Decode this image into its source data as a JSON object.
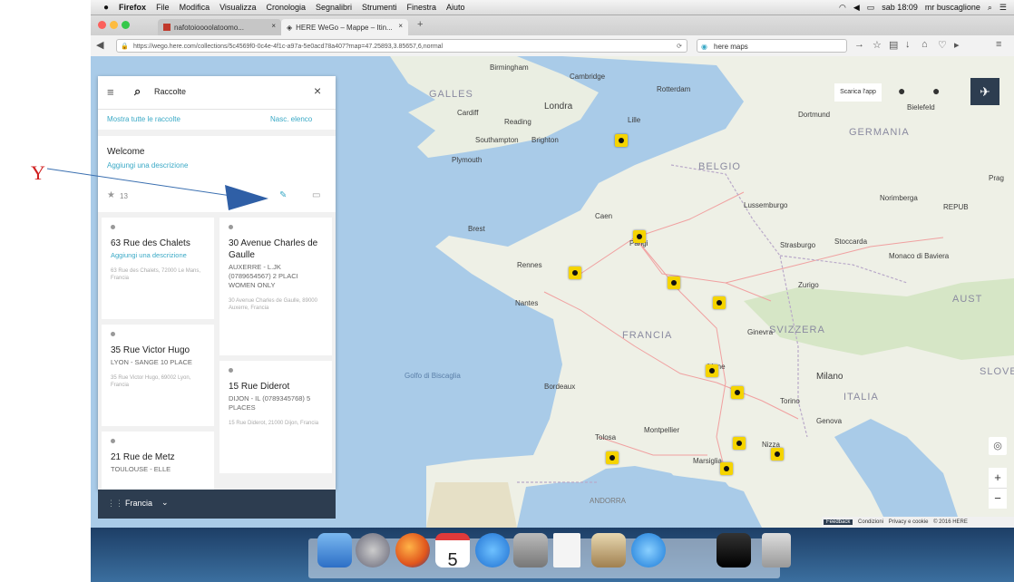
{
  "annotation": {
    "letter": "Y",
    "color": "#d02020"
  },
  "menubar": {
    "apple": "",
    "items": [
      "Firefox",
      "File",
      "Modifica",
      "Visualizza",
      "Cronologia",
      "Segnalibri",
      "Strumenti",
      "Finestra",
      "Aiuto"
    ],
    "clock": "sab 18:09",
    "user": "mr buscaglione"
  },
  "tabs": [
    {
      "label": "nafotoioooolatoomo..."
    },
    {
      "label": "HERE WeGo – Mappe – Itin..."
    }
  ],
  "navbar": {
    "url": "https://wego.here.com/collections/5c4569f0-0c4e-4f1c-a97a-5e0acd78a407?map=47.25893,3.85657,6,normal",
    "search_value": "here maps"
  },
  "panel": {
    "search_label": "Raccolte",
    "show_all": "Mostra tutte le raccolte",
    "hide_list": "Nasc. elenco",
    "collection_title": "Welcome",
    "add_description": "Aggiungi una descrizione",
    "place_count": "13",
    "cards_left": [
      {
        "title": "63 Rue des Chalets",
        "desc": "Aggiungi una descrizione",
        "sub": "",
        "addr": "63 Rue des Chalets, 72000 Le Mans, Francia"
      },
      {
        "title": "35 Rue Victor Hugo",
        "desc": "",
        "sub": "LYON - SANGE 10 PLACE",
        "addr": "35 Rue Victor Hugo, 69002 Lyon, Francia"
      },
      {
        "title": "21 Rue de Metz",
        "desc": "",
        "sub": "TOULOUSE - ELLE",
        "addr": ""
      }
    ],
    "cards_right": [
      {
        "title": "30 Avenue Charles de Gaulle",
        "desc": "",
        "sub": "AUXERRE - L.JK (0789654567) 2 PLACI WOMEN ONLY",
        "addr": "30 Avenue Charles de Gaulle, 89000 Auxerre, Francia"
      },
      {
        "title": "15 Rue Diderot",
        "desc": "",
        "sub": "DIJON - IL (0789345768) 5 PLACES",
        "addr": "15 Rue Diderot, 21000 Dijon, Francia"
      }
    ],
    "country": "Francia"
  },
  "map": {
    "download_label": "Scarica l'app",
    "labels": {
      "galles": "GALLES",
      "londra": "Londra",
      "cardiff": "Cardiff",
      "reading": "Reading",
      "southampton": "Southampton",
      "brighton": "Brighton",
      "plymouth": "Plymouth",
      "birmingham": "Birmingham",
      "cambridge": "Cambridge",
      "rotterdam": "Rotterdam",
      "germania": "GERMANIA",
      "belgio": "BELGIO",
      "francia": "FRANCIA",
      "svizzera": "SVIZZERA",
      "italia": "ITALIA",
      "austria": "AUST",
      "repub": "REPUB",
      "slovenia": "SLOVEN",
      "nantes": "Nantes",
      "parigi": "Parigi",
      "milano": "Milano",
      "marsiglia": "Marsiglia",
      "monaco": "Monaco di Baviera",
      "golfo": "Golfo di Biscaglia",
      "praga": "Prag",
      "stoccarda": "Stoccarda",
      "norimberga": "Norimberga",
      "andorra": "ANDORRA",
      "berlino": "Bielefeld",
      "amburgo": "Dortmund",
      "lussemburgo": "Lussemburgo",
      "strasburgo": "Strasburgo",
      "zurigo": "Zurigo",
      "ginevra": "Ginevra",
      "lione": "Lione",
      "bordeaux": "Bordeaux",
      "tolosa": "Tolosa",
      "montpellier": "Montpellier",
      "nizza": "Nizza",
      "torino": "Torino",
      "genova": "Genova",
      "brest": "Brest",
      "rennes": "Rennes",
      "caen": "Caen",
      "lille": "Lille"
    },
    "footer": [
      "Feedback",
      "Condizioni",
      "Privacy e cookie",
      "© 2016 HERE"
    ]
  },
  "dock": {
    "calendar_day": "5"
  },
  "colors": {
    "accent": "#3aa9c6",
    "pin": "#f5d400",
    "water": "#a9cbe8",
    "land": "#eef0e6",
    "country_bar": "#2d3d50"
  }
}
